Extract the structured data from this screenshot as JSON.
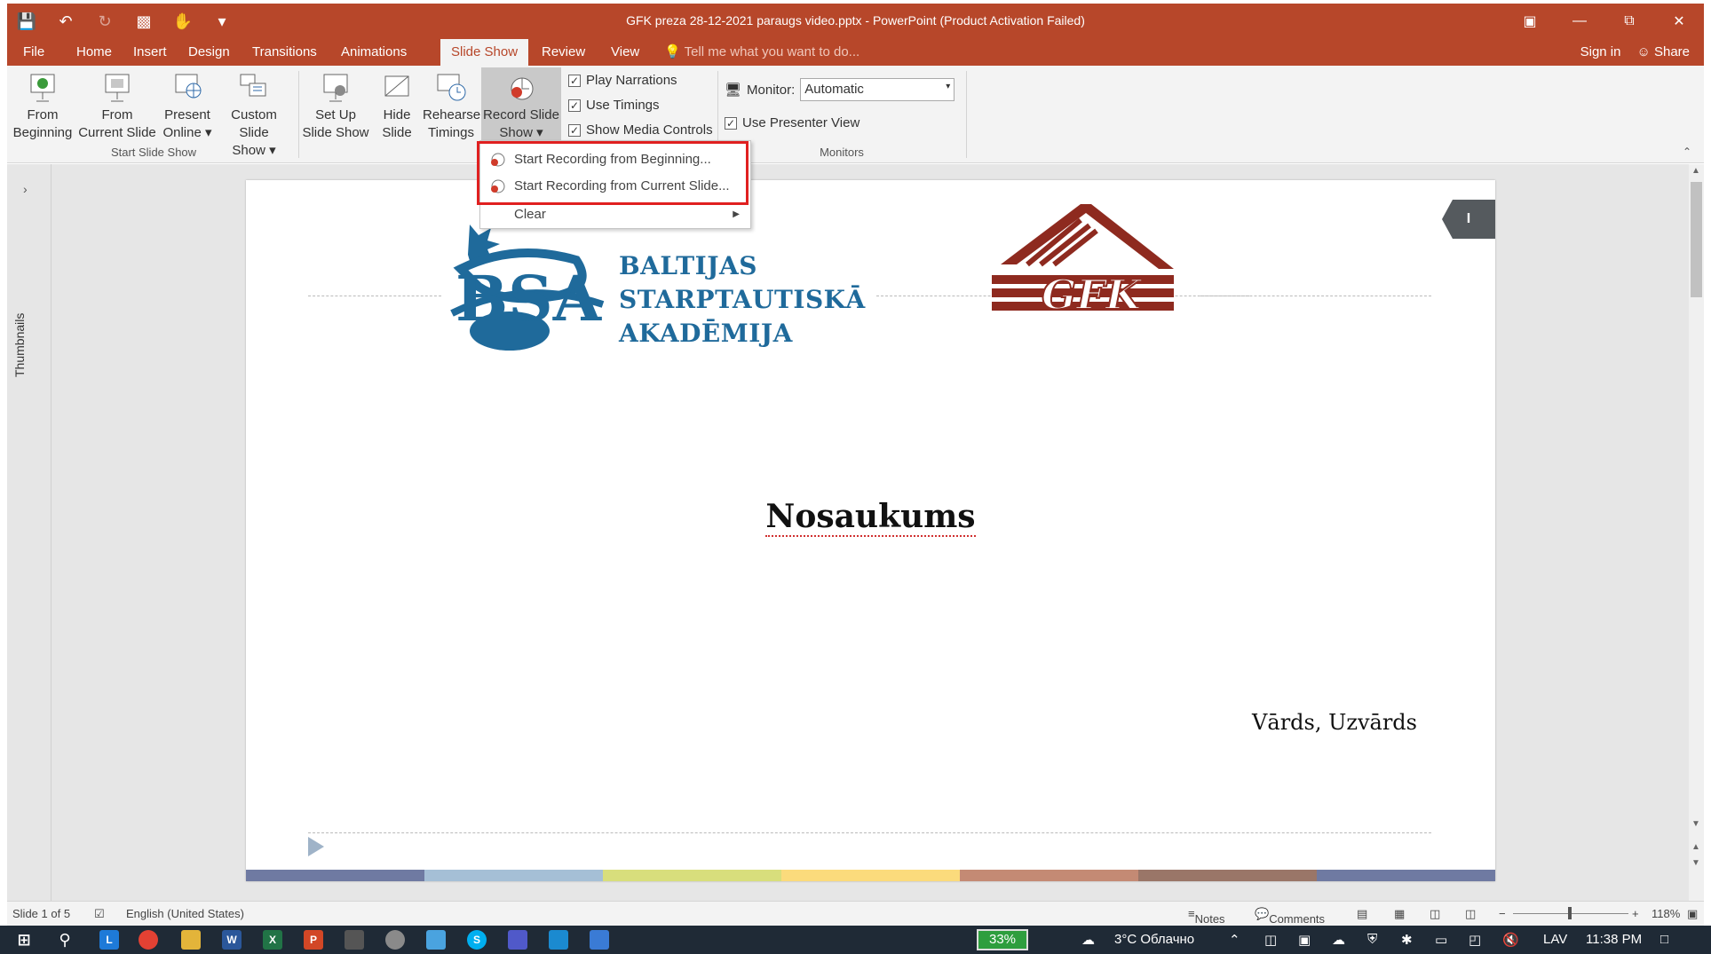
{
  "window": {
    "title": "GFK preza 28-12-2021 paraugs video.pptx - PowerPoint (Product Activation Failed)",
    "qat_icons": [
      "save-icon",
      "undo-icon",
      "redo-icon",
      "present-icon",
      "touch-mode-icon",
      "customize-icon"
    ]
  },
  "tabs": {
    "items": [
      "File",
      "Home",
      "Insert",
      "Design",
      "Transitions",
      "Animations",
      "Slide Show",
      "Review",
      "View"
    ],
    "active": "Slide Show",
    "tell_me": "Tell me what you want to do...",
    "sign_in": "Sign in",
    "share": "Share"
  },
  "ribbon": {
    "from_beginning": [
      "From",
      "Beginning"
    ],
    "from_current": [
      "From",
      "Current Slide"
    ],
    "present_online": [
      "Present",
      "Online"
    ],
    "custom_show": [
      "Custom Slide",
      "Show"
    ],
    "start_group": "Start Slide Show",
    "setup_show": [
      "Set Up",
      "Slide Show"
    ],
    "hide_slide": [
      "Hide",
      "Slide"
    ],
    "rehearse": [
      "Rehearse",
      "Timings"
    ],
    "record": [
      "Record Slide",
      "Show"
    ],
    "play_narrations": "Play Narrations",
    "use_timings": "Use Timings",
    "show_media_controls": "Show Media Controls",
    "monitor_label": "Monitor:",
    "monitor_value": "Automatic",
    "presenter_view": "Use Presenter View",
    "monitors_group": "Monitors"
  },
  "dropdown": {
    "items": [
      "Start Recording from Beginning...",
      "Start Recording from Current Slide...",
      "Clear"
    ]
  },
  "thumbnails_label": "Thumbnails",
  "slide": {
    "academy": [
      "BALTIJAS",
      "STARPTAUTISKĀ",
      "AKADĒMIJA"
    ],
    "logo_left_text": "BSA",
    "logo_right_text": "GFK",
    "title": "Nosaukums",
    "author": "Vārds, Uzvārds",
    "number_tag": "I",
    "colors": [
      "#6f7aa2",
      "#a5bfd6",
      "#d8de7c",
      "#fbdb7c",
      "#c48a74",
      "#9a7668",
      "#6f7aa2"
    ]
  },
  "status": {
    "slide": "Slide 1 of 5",
    "language": "English (United States)",
    "notes": "Notes",
    "comments": "Comments",
    "zoom": "118%"
  },
  "taskbar": {
    "battery": "33%",
    "weather": "3°C Облачно",
    "lang": "LAV",
    "time": "11:38 PM"
  }
}
